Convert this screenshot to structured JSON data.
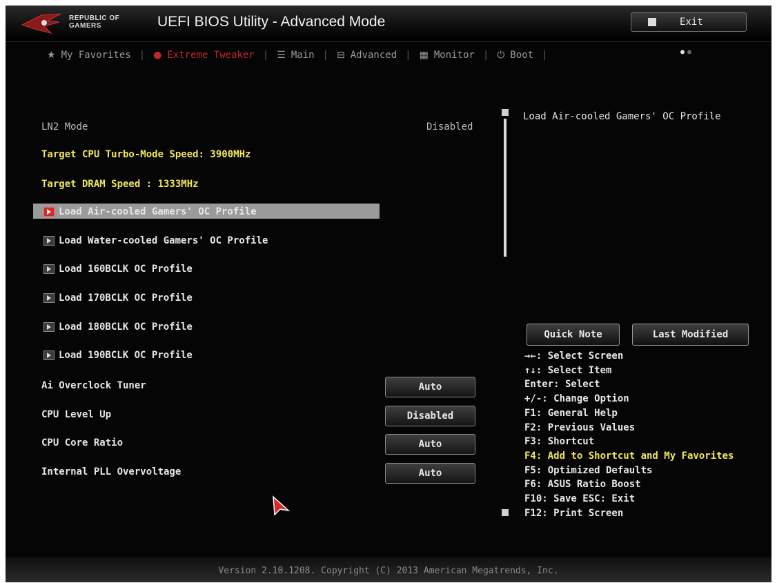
{
  "header": {
    "brand_line1": "REPUBLIC OF",
    "brand_line2": "GAMERS",
    "title": "UEFI BIOS Utility - Advanced Mode",
    "exit_label": "Exit"
  },
  "nav": {
    "tabs": [
      {
        "label": "My Favorites",
        "icon": "star-icon"
      },
      {
        "label": "Extreme Tweaker",
        "icon": "tweaker-icon",
        "active": true
      },
      {
        "label": "Main",
        "icon": "list-icon"
      },
      {
        "label": "Advanced",
        "icon": "advanced-icon"
      },
      {
        "label": "Monitor",
        "icon": "monitor-icon"
      },
      {
        "label": "Boot",
        "icon": "power-icon"
      }
    ]
  },
  "main": {
    "ln2_mode": {
      "label": "LN2 Mode",
      "value": "Disabled"
    },
    "target_cpu": "Target CPU Turbo-Mode Speed: 3900MHz",
    "target_dram": "Target DRAM Speed : 1333MHz",
    "profiles": [
      "Load Air-cooled Gamers'  OC Profile",
      "Load Water-cooled Gamers'  OC Profile",
      "Load 160BCLK OC Profile",
      "Load 170BCLK OC Profile",
      "Load 180BCLK OC Profile",
      "Load 190BCLK OC Profile"
    ],
    "settings": [
      {
        "label": "Ai Overclock Tuner",
        "value": "Auto"
      },
      {
        "label": "CPU Level Up",
        "value": "Disabled"
      },
      {
        "label": "CPU Core Ratio",
        "value": "Auto"
      },
      {
        "label": "Internal PLL Overvoltage",
        "value": "Auto"
      }
    ]
  },
  "help": {
    "title": "Load Air-cooled Gamers'  OC Profile",
    "quick_note": "Quick Note",
    "last_modified": "Last Modified",
    "keys": [
      "→←: Select Screen",
      "↑↓: Select Item",
      "Enter: Select",
      "+/-: Change Option",
      "F1: General Help",
      "F2: Previous Values",
      "F3: Shortcut",
      "F4: Add to Shortcut and My Favorites",
      "F5: Optimized Defaults",
      "F6: ASUS Ratio Boost",
      "F10: Save  ESC: Exit",
      "F12: Print Screen"
    ]
  },
  "footer": {
    "version": "Version 2.10.1208. Copyright (C) 2013 American Megatrends, Inc."
  },
  "colors": {
    "accent_red": "#c1272d",
    "highlight_yellow": "#f1e65a",
    "background": "#050505"
  }
}
